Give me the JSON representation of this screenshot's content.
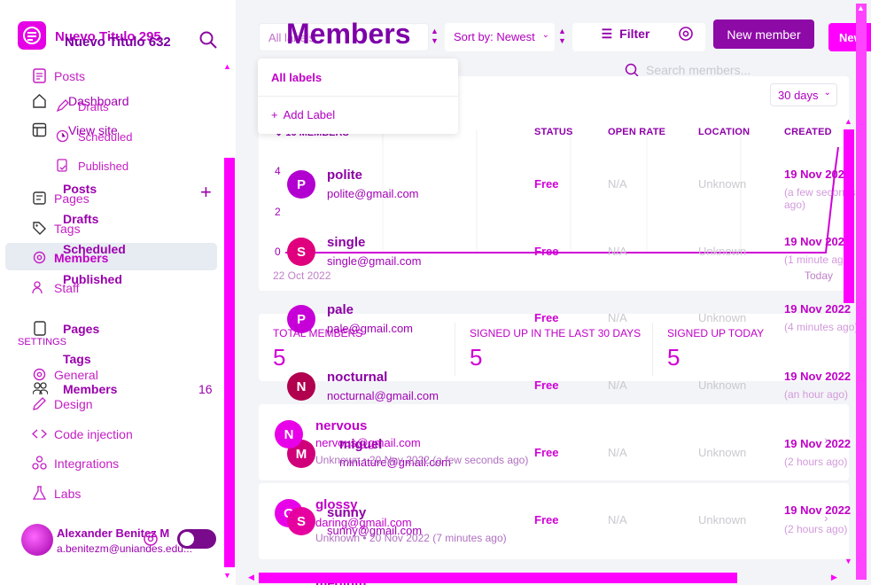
{
  "sidebar": {
    "site_title_a": "Nuevo Titulo 295",
    "site_title_b": "Nuevo Titulo 632",
    "nav_a": [
      {
        "label": "Posts"
      },
      {
        "label": "Dashboard"
      },
      {
        "label": "View site"
      },
      {
        "label": "Posts"
      },
      {
        "label": "Pages"
      },
      {
        "label": "Tags"
      },
      {
        "label": "Members"
      },
      {
        "label": "Staff"
      }
    ],
    "sub_posts": [
      "Drafts",
      "Scheduled",
      "Published"
    ],
    "nav_b": [
      {
        "label": "Drafts"
      },
      {
        "label": "Scheduled"
      },
      {
        "label": "Published"
      },
      {
        "label": "Pages"
      },
      {
        "label": "Tags"
      },
      {
        "label": "Members",
        "count": "16"
      }
    ],
    "settings_header": "SETTINGS",
    "settings": [
      {
        "label": "General"
      },
      {
        "label": "Design"
      },
      {
        "label": "Code injection"
      },
      {
        "label": "Integrations"
      },
      {
        "label": "Labs"
      }
    ],
    "user": {
      "name": "Alexander Benitez M",
      "email": "a.benitezm@uniandes.edu..."
    }
  },
  "header": {
    "title": "Members",
    "label_filter": "All labels",
    "sort": "Sort by: Newest",
    "filter": "Filter",
    "search_placeholder": "Search members...",
    "new_member": "New member",
    "new_short": "New"
  },
  "label_dropdown": {
    "all": "All labels",
    "add": "Add Label"
  },
  "chart": {
    "range": "30 days",
    "count_label": "16 MEMBERS",
    "y_ticks": [
      "4",
      "2",
      "0"
    ],
    "start_date": "22 Oct 2022",
    "end_date": "Today"
  },
  "stats": [
    {
      "label": "TOTAL MEMBERS",
      "value": "5"
    },
    {
      "label": "SIGNED UP IN THE LAST 30 DAYS",
      "value": "5"
    },
    {
      "label": "SIGNED UP TODAY",
      "value": "5"
    }
  ],
  "table": {
    "columns": [
      "STATUS",
      "OPEN RATE",
      "LOCATION",
      "CREATED"
    ],
    "rows": [
      {
        "initial": "P",
        "name": "polite",
        "email": "polite@gmail.com",
        "status": "Free",
        "open": "N/A",
        "location": "Unknown",
        "date": "19 Nov 2022",
        "ago": "(a few seconds ago)"
      },
      {
        "initial": "S",
        "name": "single",
        "email": "single@gmail.com",
        "status": "Free",
        "open": "N/A",
        "location": "Unknown",
        "date": "19 Nov 2022",
        "ago": "(1 minute ago)"
      },
      {
        "initial": "P",
        "name": "pale",
        "email": "pale@gmail.com",
        "status": "Free",
        "open": "N/A",
        "location": "Unknown",
        "date": "19 Nov 2022",
        "ago": "(4 minutes ago)"
      },
      {
        "initial": "N",
        "name": "nocturnal",
        "email": "nocturnal@gmail.com",
        "status": "Free",
        "open": "N/A",
        "location": "Unknown",
        "date": "19 Nov 2022",
        "ago": "(an hour ago)"
      },
      {
        "initial": "M",
        "name": "miguel",
        "email": "miniature@gmail.com",
        "status": "Free",
        "open": "N/A",
        "location": "Unknown",
        "date": "19 Nov 2022",
        "ago": "(2 hours ago)"
      },
      {
        "initial": "S",
        "name": "sunny",
        "email": "sunny@gmail.com",
        "status": "Free",
        "open": "N/A",
        "location": "Unknown",
        "date": "19 Nov 2022",
        "ago": "(2 hours ago)"
      }
    ],
    "ghost_rows": [
      {
        "initial": "N",
        "name": "nervous",
        "email": "nervous@gmail.com",
        "meta": "Unknown • 20 Nov 2022 (a few seconds ago)"
      },
      {
        "initial": "G",
        "name": "glossy",
        "email": "daring@gmail.com",
        "meta": "Unknown • 20 Nov 2022 (7 minutes ago)"
      },
      {
        "initial": "M",
        "name": "medium"
      }
    ]
  },
  "colors": {
    "accent": "#ff00ff",
    "brand": "#8e0aa6",
    "sidebar_active": "#e7ebf2"
  }
}
